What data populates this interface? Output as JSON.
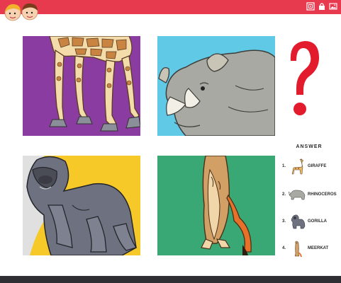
{
  "header": {
    "bar_color": "#e83a4f",
    "icons": [
      "qr-code-icon",
      "lock-icon",
      "image-icon"
    ]
  },
  "puzzle": {
    "panels": [
      {
        "animal": "giraffe",
        "background": "#8b3ca0"
      },
      {
        "animal": "rhinoceros",
        "background": "#5fc9e6"
      },
      {
        "animal": "gorilla",
        "background": "#f6c928"
      },
      {
        "animal": "meerkat",
        "background": "#3aa874"
      }
    ],
    "question_mark_color": "#e21b2d"
  },
  "answer": {
    "title": "ANSWER",
    "items": [
      {
        "num": "1.",
        "label": "GIRAFFE"
      },
      {
        "num": "2.",
        "label": "RHINOCEROS"
      },
      {
        "num": "3.",
        "label": "GORILLA"
      },
      {
        "num": "4.",
        "label": "MEERKAT"
      }
    ]
  }
}
